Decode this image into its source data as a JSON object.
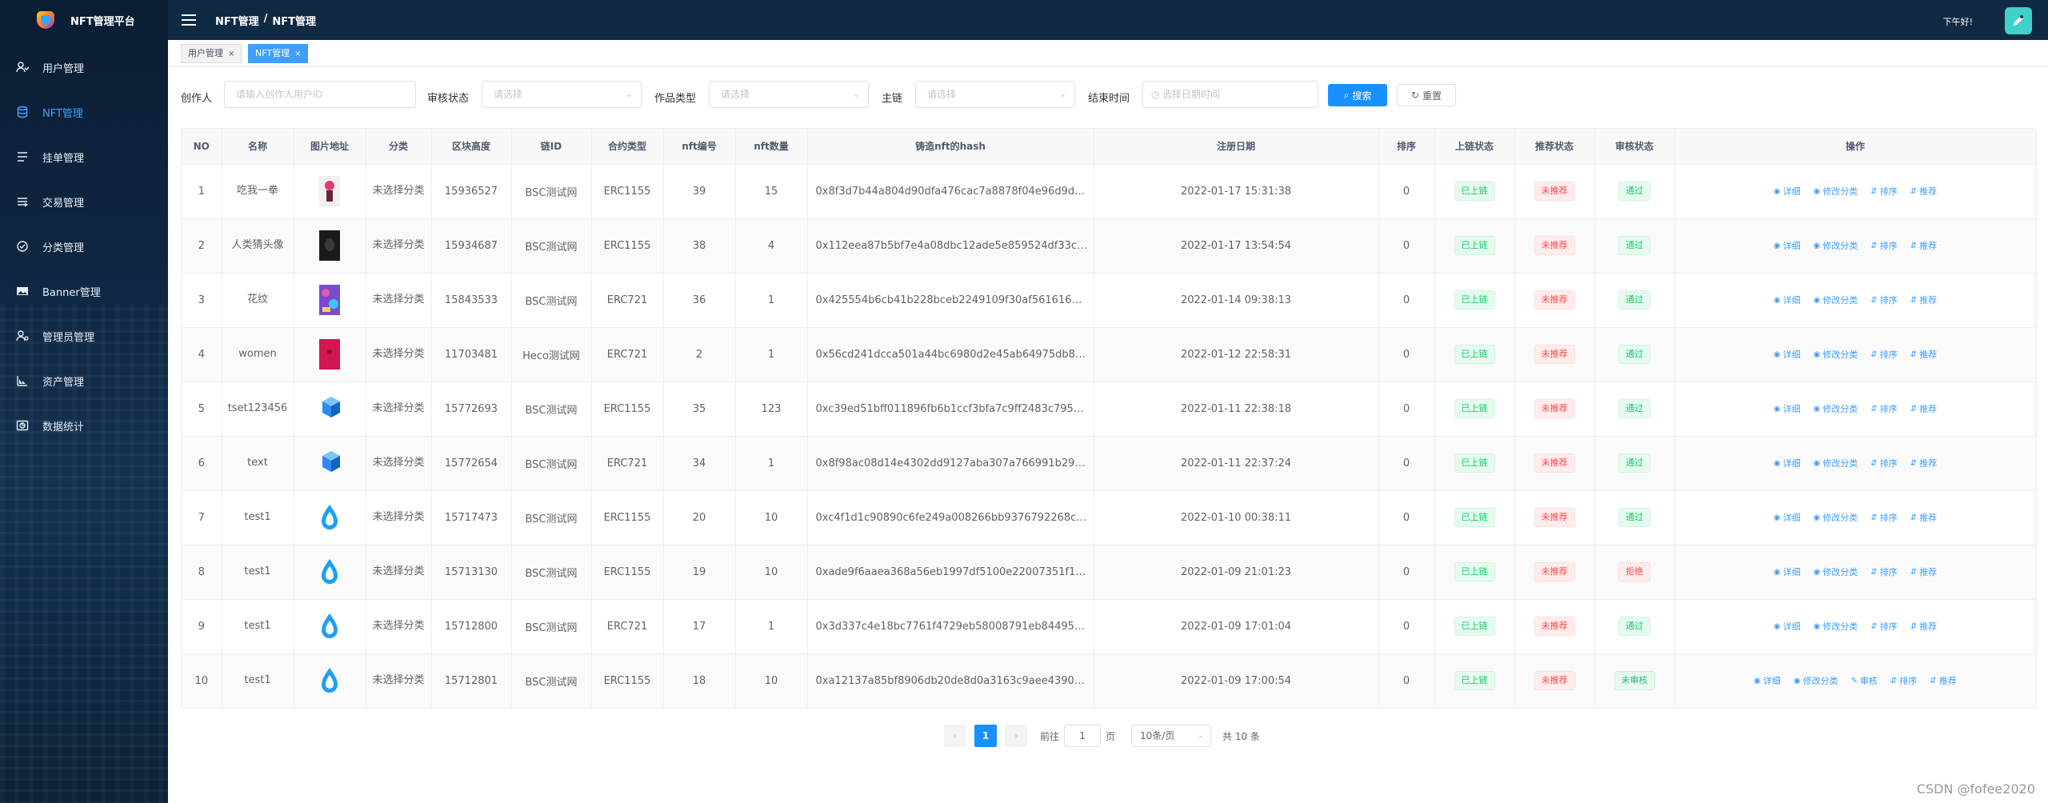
{
  "brand": {
    "title": "NFT管理平台"
  },
  "sidebar": {
    "items": [
      {
        "label": "用户管理",
        "icon": "user-icon"
      },
      {
        "label": "NFT管理",
        "icon": "database-icon"
      },
      {
        "label": "挂单管理",
        "icon": "list-icon"
      },
      {
        "label": "交易管理",
        "icon": "transaction-icon"
      },
      {
        "label": "分类管理",
        "icon": "category-icon"
      },
      {
        "label": "Banner管理",
        "icon": "image-icon"
      },
      {
        "label": "管理员管理",
        "icon": "admin-icon"
      },
      {
        "label": "资产管理",
        "icon": "asset-icon"
      },
      {
        "label": "数据统计",
        "icon": "stats-icon"
      }
    ]
  },
  "header": {
    "crumb1": "NFT管理",
    "sep": "/",
    "crumb2": "NFT管理",
    "greeting": "下午好!"
  },
  "tags": [
    {
      "label": "用户管理",
      "close": "×"
    },
    {
      "label": "NFT管理",
      "close": "×"
    }
  ],
  "filter": {
    "creator_label": "创作人",
    "creator_placeholder": "请输入创作人用户ID",
    "review_label": "审核状态",
    "review_placeholder": "请选择",
    "type_label": "作品类型",
    "type_placeholder": "请选择",
    "chain_label": "主链",
    "chain_placeholder": "请选择",
    "end_label": "结束时间",
    "end_placeholder": "选择日期时间",
    "search_label": "搜索",
    "reset_label": "重置"
  },
  "table": {
    "headers": [
      "NO",
      "名称",
      "图片地址",
      "分类",
      "区块高度",
      "链ID",
      "合约类型",
      "nft编号",
      "nft数量",
      "铸造nft的hash",
      "注册日期",
      "排序",
      "上链状态",
      "推荐状态",
      "审核状态",
      "操作"
    ],
    "rows": [
      {
        "no": "1",
        "name": "吃我一拳",
        "cat": "未选择分类",
        "block": "15936527",
        "chain": "BSC测试网",
        "contract": "ERC1155",
        "nft_no": "39",
        "qty": "15",
        "hash": "0x8f3d7b44a804d90dfa476cac7a8878f04e96d9dac...",
        "date": "2022-01-17 15:31:38",
        "sort": "0",
        "chain_status": "已上链",
        "rec": "未推荐",
        "review": "通过",
        "review_type": "green",
        "ops": [
          "详细",
          "修改分类",
          "排序",
          "推荐"
        ],
        "thumb": "pink"
      },
      {
        "no": "2",
        "name": "人类猜头像",
        "cat": "未选择分类",
        "block": "15934687",
        "chain": "BSC测试网",
        "contract": "ERC1155",
        "nft_no": "38",
        "qty": "4",
        "hash": "0x112eea87b5bf7e4a08dbc12ade5e859524df33c9...",
        "date": "2022-01-17 13:54:54",
        "sort": "0",
        "chain_status": "已上链",
        "rec": "未推荐",
        "review": "通过",
        "review_type": "green",
        "ops": [
          "详细",
          "修改分类",
          "排序",
          "推荐"
        ],
        "thumb": "dark"
      },
      {
        "no": "3",
        "name": "花纹",
        "cat": "未选择分类",
        "block": "15843533",
        "chain": "BSC测试网",
        "contract": "ERC721",
        "nft_no": "36",
        "qty": "1",
        "hash": "0x425554b6cb41b228bceb2249109f30af561616d7...",
        "date": "2022-01-14 09:38:13",
        "sort": "0",
        "chain_status": "已上链",
        "rec": "未推荐",
        "review": "通过",
        "review_type": "green",
        "ops": [
          "详细",
          "修改分类",
          "排序",
          "推荐"
        ],
        "thumb": "pattern"
      },
      {
        "no": "4",
        "name": "women",
        "cat": "未选择分类",
        "block": "11703481",
        "chain": "Heco测试网",
        "contract": "ERC721",
        "nft_no": "2",
        "qty": "1",
        "hash": "0x56cd241dcca501a44bc6980d2e45ab64975db86f...",
        "date": "2022-01-12 22:58:31",
        "sort": "0",
        "chain_status": "已上链",
        "rec": "未推荐",
        "review": "通过",
        "review_type": "green",
        "ops": [
          "详细",
          "修改分类",
          "排序",
          "推荐"
        ],
        "thumb": "red"
      },
      {
        "no": "5",
        "name": "tset123456",
        "cat": "未选择分类",
        "block": "15772693",
        "chain": "BSC测试网",
        "contract": "ERC1155",
        "nft_no": "35",
        "qty": "123",
        "hash": "0xc39ed51bff011896fb6b1ccf3bfa7c9ff2483c79527...",
        "date": "2022-01-11 22:38:18",
        "sort": "0",
        "chain_status": "已上链",
        "rec": "未推荐",
        "review": "通过",
        "review_type": "green",
        "ops": [
          "详细",
          "修改分类",
          "排序",
          "推荐"
        ],
        "thumb": "cube"
      },
      {
        "no": "6",
        "name": "text",
        "cat": "未选择分类",
        "block": "15772654",
        "chain": "BSC测试网",
        "contract": "ERC721",
        "nft_no": "34",
        "qty": "1",
        "hash": "0x8f98ac08d14e4302dd9127aba307a766991b2994...",
        "date": "2022-01-11 22:37:24",
        "sort": "0",
        "chain_status": "已上链",
        "rec": "未推荐",
        "review": "通过",
        "review_type": "green",
        "ops": [
          "详细",
          "修改分类",
          "排序",
          "推荐"
        ],
        "thumb": "cube"
      },
      {
        "no": "7",
        "name": "test1",
        "cat": "未选择分类",
        "block": "15717473",
        "chain": "BSC测试网",
        "contract": "ERC1155",
        "nft_no": "20",
        "qty": "10",
        "hash": "0xc4f1d1c90890c6fe249a008266bb9376792268ca...",
        "date": "2022-01-10 00:38:11",
        "sort": "0",
        "chain_status": "已上链",
        "rec": "未推荐",
        "review": "通过",
        "review_type": "green",
        "ops": [
          "详细",
          "修改分类",
          "排序",
          "推荐"
        ],
        "thumb": "drop"
      },
      {
        "no": "8",
        "name": "test1",
        "cat": "未选择分类",
        "block": "15713130",
        "chain": "BSC测试网",
        "contract": "ERC1155",
        "nft_no": "19",
        "qty": "10",
        "hash": "0xade9f6aaea368a56eb1997df5100e22007351f1f7...",
        "date": "2022-01-09 21:01:23",
        "sort": "0",
        "chain_status": "已上链",
        "rec": "未推荐",
        "review": "拒绝",
        "review_type": "red",
        "ops": [
          "详细",
          "修改分类",
          "排序",
          "推荐"
        ],
        "thumb": "drop"
      },
      {
        "no": "9",
        "name": "test1",
        "cat": "未选择分类",
        "block": "15712800",
        "chain": "BSC测试网",
        "contract": "ERC721",
        "nft_no": "17",
        "qty": "1",
        "hash": "0x3d337c4e18bc7761f4729eb58008791eb8449548...",
        "date": "2022-01-09 17:01:04",
        "sort": "0",
        "chain_status": "已上链",
        "rec": "未推荐",
        "review": "通过",
        "review_type": "green",
        "ops": [
          "详细",
          "修改分类",
          "排序",
          "推荐"
        ],
        "thumb": "drop"
      },
      {
        "no": "10",
        "name": "test1",
        "cat": "未选择分类",
        "block": "15712801",
        "chain": "BSC测试网",
        "contract": "ERC1155",
        "nft_no": "18",
        "qty": "10",
        "hash": "0xa12137a85bf8906db20de8d0a3163c9aee439094...",
        "date": "2022-01-09 17:00:54",
        "sort": "0",
        "chain_status": "已上链",
        "rec": "未推荐",
        "review": "未审核",
        "review_type": "gray",
        "ops": [
          "详细",
          "修改分类",
          "审核",
          "排序",
          "推荐"
        ],
        "thumb": "drop"
      }
    ]
  },
  "pagination": {
    "prev": "‹",
    "current": "1",
    "next": "›",
    "goto": "前往",
    "page_value": "1",
    "page_unit": "页",
    "page_size": "10条/页",
    "total": "共 10 条"
  },
  "watermark": "CSDN @fofee2020",
  "colors": {
    "accent": "#1890ff",
    "sidebar_bg": "#0f2742",
    "header_bg": "#102a44"
  }
}
